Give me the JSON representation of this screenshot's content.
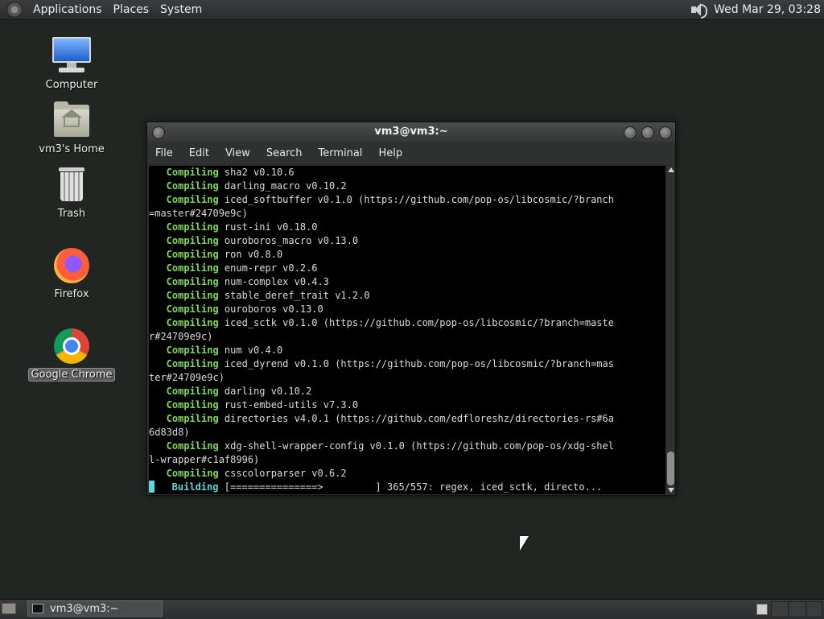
{
  "top_panel": {
    "menus": [
      "Applications",
      "Places",
      "System"
    ],
    "clock": "Wed Mar 29, 03:28"
  },
  "desktop_icons": [
    {
      "label": "Computer"
    },
    {
      "label": "vm3's Home"
    },
    {
      "label": "Trash"
    },
    {
      "label": "Firefox"
    },
    {
      "label": "Google Chrome"
    }
  ],
  "terminal": {
    "title": "vm3@vm3:~",
    "menu": [
      "File",
      "Edit",
      "View",
      "Search",
      "Terminal",
      "Help"
    ],
    "lines": [
      {
        "kw": "   Compiling",
        "text": " sha2 v0.10.6"
      },
      {
        "kw": "   Compiling",
        "text": " darling_macro v0.10.2"
      },
      {
        "kw": "   Compiling",
        "text": " iced_softbuffer v0.1.0 (https://github.com/pop-os/libcosmic/?branch"
      },
      {
        "kw": "",
        "text": "=master#24709e9c)"
      },
      {
        "kw": "   Compiling",
        "text": " rust-ini v0.18.0"
      },
      {
        "kw": "   Compiling",
        "text": " ouroboros_macro v0.13.0"
      },
      {
        "kw": "   Compiling",
        "text": " ron v0.8.0"
      },
      {
        "kw": "   Compiling",
        "text": " enum-repr v0.2.6"
      },
      {
        "kw": "   Compiling",
        "text": " num-complex v0.4.3"
      },
      {
        "kw": "   Compiling",
        "text": " stable_deref_trait v1.2.0"
      },
      {
        "kw": "   Compiling",
        "text": " ouroboros v0.13.0"
      },
      {
        "kw": "   Compiling",
        "text": " iced_sctk v0.1.0 (https://github.com/pop-os/libcosmic/?branch=maste"
      },
      {
        "kw": "",
        "text": "r#24709e9c)"
      },
      {
        "kw": "   Compiling",
        "text": " num v0.4.0"
      },
      {
        "kw": "   Compiling",
        "text": " iced_dyrend v0.1.0 (https://github.com/pop-os/libcosmic/?branch=mas"
      },
      {
        "kw": "",
        "text": "ter#24709e9c)"
      },
      {
        "kw": "   Compiling",
        "text": " darling v0.10.2"
      },
      {
        "kw": "   Compiling",
        "text": " rust-embed-utils v7.3.0"
      },
      {
        "kw": "   Compiling",
        "text": " directories v4.0.1 (https://github.com/edfloreshz/directories-rs#6a"
      },
      {
        "kw": "",
        "text": "6d83d8)"
      },
      {
        "kw": "   Compiling",
        "text": " xdg-shell-wrapper-config v0.1.0 (https://github.com/pop-os/xdg-shel"
      },
      {
        "kw": "",
        "text": "l-wrapper#c1af8996)"
      },
      {
        "kw": "   Compiling",
        "text": " csscolorparser v0.6.2"
      }
    ],
    "progress_line": {
      "kw": "    Building",
      "text": " [===============>         ] 365/557: regex, iced_sctk, directo..."
    }
  },
  "taskbar": {
    "window_button": "vm3@vm3:~"
  },
  "colors": {
    "keyword_green": "#7ed957",
    "keyword_cyan": "#5fd7d7",
    "desktop_bg": "#222623"
  }
}
